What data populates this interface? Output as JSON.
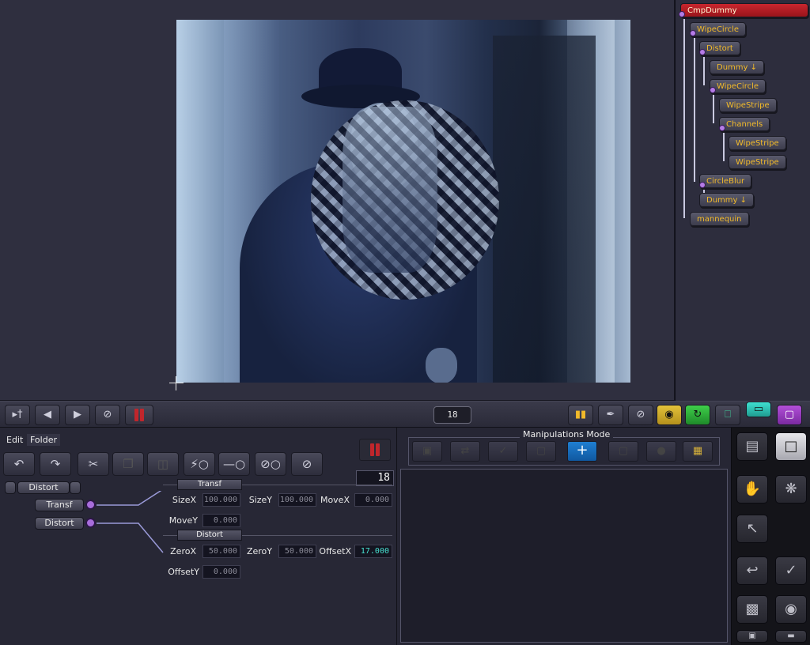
{
  "viewer": {
    "frame_counter": "18"
  },
  "tree": {
    "nodes": [
      {
        "label": "CmpDummy",
        "selected": true
      },
      {
        "label": "WipeCircle"
      },
      {
        "label": "Distort"
      },
      {
        "label": "Dummy ↓"
      },
      {
        "label": "WipeCircle"
      },
      {
        "label": "WipeStripe"
      },
      {
        "label": "Channels"
      },
      {
        "label": "WipeStripe"
      },
      {
        "label": "WipeStripe"
      },
      {
        "label": "CircleBlur"
      },
      {
        "label": "Dummy ↓"
      },
      {
        "label": "mannequin"
      }
    ]
  },
  "params": {
    "menu": {
      "edit": "Edit",
      "folder": "Folder"
    },
    "frame": "18",
    "node": "Distort",
    "inputs": [
      {
        "label": "Transf"
      },
      {
        "label": "Distort"
      }
    ],
    "transf": {
      "section": "Transf",
      "sizex_label": "SizeX",
      "sizex": "100.000",
      "sizey_label": "SizeY",
      "sizey": "100.000",
      "movex_label": "MoveX",
      "movex": "0.000",
      "movey_label": "MoveY",
      "movey": "0.000"
    },
    "distort": {
      "section": "Distort",
      "zerox_label": "ZeroX",
      "zerox": "50.000",
      "zeroy_label": "ZeroY",
      "zeroy": "50.000",
      "offsetx_label": "OffsetX",
      "offsetx": "17.000",
      "offsety_label": "OffsetY",
      "offsety": "0.000"
    }
  },
  "manip": {
    "title": "Manipulations Mode"
  },
  "colors": {
    "node_text": "#f2ba2a",
    "selected_node": "#c8262e",
    "plug": "#a86ddc",
    "active_field": "#47e0d0",
    "active_mode": "#1f7fd1"
  }
}
